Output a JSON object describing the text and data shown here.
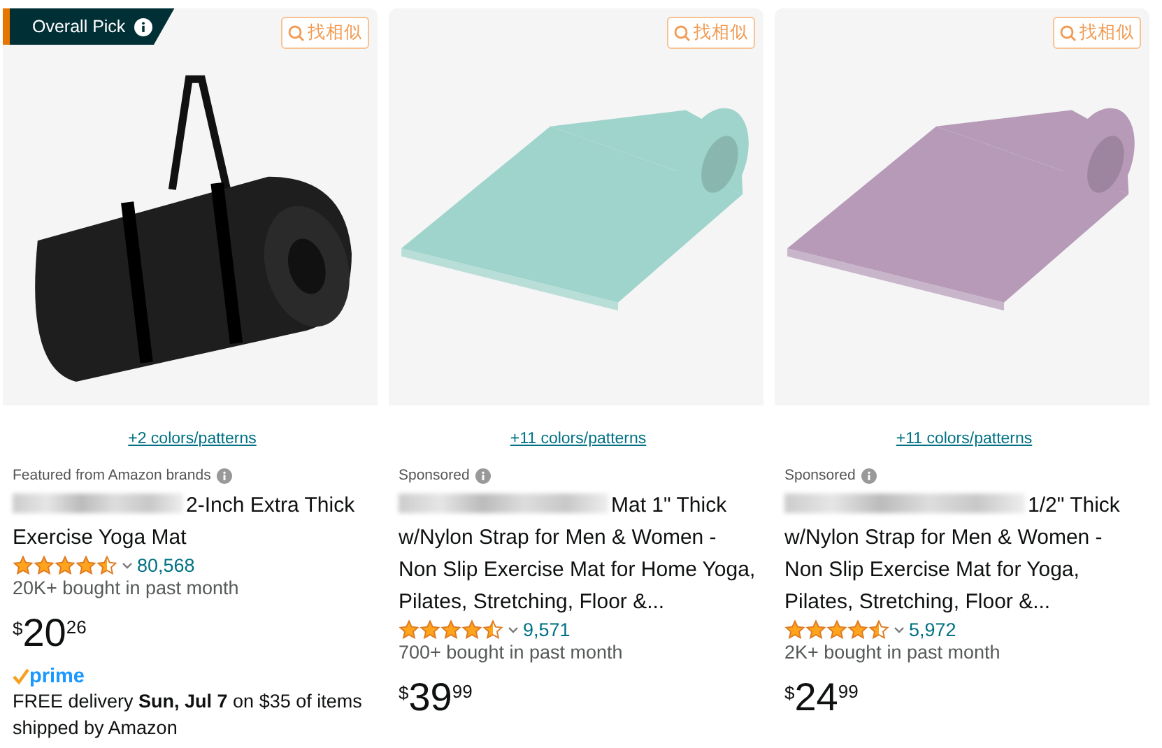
{
  "products": [
    {
      "badge": "Overall Pick",
      "similar_button": "找相似",
      "image": {
        "kind": "strap",
        "color": "#1e1e1e"
      },
      "variants_link": "+2 colors/patterns",
      "label": "Featured from Amazon brands",
      "title_redacted": true,
      "title": "2-Inch Extra Thick Exercise Yoga Mat",
      "stars": 4.5,
      "rating_count": "80,568",
      "bought": "20K+ bought in past month",
      "price": {
        "symbol": "$",
        "whole": "20",
        "fraction": "26"
      },
      "prime": "prime",
      "delivery": "FREE delivery **Sun, Jul 7** on $35 of items shipped by Amazon"
    },
    {
      "similar_button": "找相似",
      "image": {
        "kind": "flat",
        "color": "#9fd4cc"
      },
      "variants_link": "+11 colors/patterns",
      "label": "Sponsored",
      "title_redacted": true,
      "title": "Mat 1\" Thick w/Nylon Strap for Men & Women - Non Slip Exercise Mat for Home Yoga, Pilates, Stretching, Floor &...",
      "stars": 4.5,
      "rating_count": "9,571",
      "bought": "700+ bought in past month",
      "price": {
        "symbol": "$",
        "whole": "39",
        "fraction": "99"
      }
    },
    {
      "similar_button": "找相似",
      "image": {
        "kind": "flat",
        "color": "#b69ab8"
      },
      "variants_link": "+11 colors/patterns",
      "label": "Sponsored",
      "title_redacted": true,
      "title": "1/2\" Thick w/Nylon Strap for Men & Women - Non Slip Exercise Mat for Yoga, Pilates, Stretching, Floor &...",
      "stars": 4.5,
      "rating_count": "5,972",
      "bought": "2K+ bought in past month",
      "price": {
        "symbol": "$",
        "whole": "24",
        "fraction": "99"
      }
    }
  ]
}
